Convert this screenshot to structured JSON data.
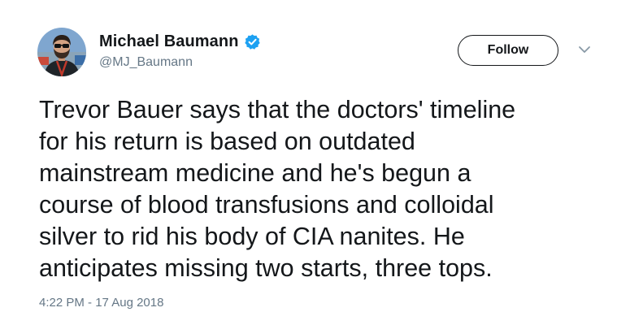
{
  "author": {
    "name": "Michael Baumann",
    "handle": "@MJ_Baumann",
    "verified": true
  },
  "follow_button": {
    "label": "Follow"
  },
  "tweet": {
    "lines": [
      "Trevor Bauer says that the doctors' timeline",
      "for his return is based on outdated",
      "mainstream medicine and he's begun a",
      "course of blood transfusions and colloidal",
      "silver to rid his body of CIA nanites. He",
      "anticipates missing two starts, three tops."
    ],
    "timestamp": "4:22 PM - 17 Aug 2018"
  },
  "icons": {
    "verified": "verified-badge-icon",
    "menu": "chevron-down-icon"
  },
  "colors": {
    "text_primary": "#14171a",
    "text_secondary": "#657786",
    "verified_blue": "#1da1f2"
  }
}
